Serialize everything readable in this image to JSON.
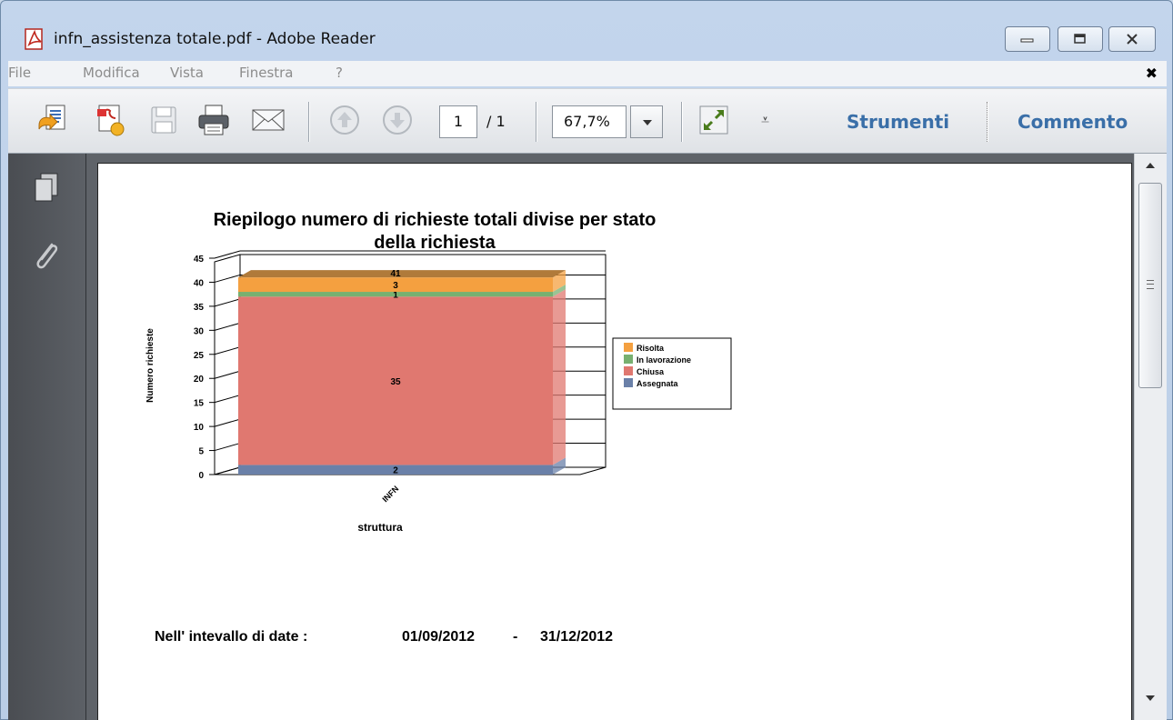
{
  "window": {
    "title": "infn_assistenza totale.pdf - Adobe Reader"
  },
  "menu": {
    "items": [
      "File",
      "Modifica",
      "Vista",
      "Finestra",
      "?"
    ],
    "close_glyph": "✖"
  },
  "toolbar": {
    "icons": [
      "create-pdf-icon",
      "export-icon",
      "save-icon",
      "print-icon",
      "email-icon",
      "page-up-icon",
      "page-down-icon",
      "fit-window-icon"
    ],
    "page_current": "1",
    "page_total": "/ 1",
    "zoom_value": "67,7%",
    "more_glyph": "⩡",
    "tools_label": "Strumenti",
    "comment_label": "Commento"
  },
  "document": {
    "date_label": "Nell' intevallo di date :",
    "date_from": "01/09/2012",
    "date_separator": "-",
    "date_to": "31/12/2012"
  },
  "chart_data": {
    "type": "bar",
    "title": "Riepilogo numero di richieste totali divise per stato della richiesta",
    "title_lines": [
      "Riepilogo numero di richieste totali divise per stato",
      "della richiesta"
    ],
    "xlabel": "struttura",
    "ylabel": "Numero richieste",
    "categories": [
      "INFN"
    ],
    "ylim": [
      0,
      45
    ],
    "yticks": [
      0,
      5,
      10,
      15,
      20,
      25,
      30,
      35,
      40,
      45
    ],
    "stacked": true,
    "total_label": "41",
    "grid": true,
    "legend_position": "right",
    "series": [
      {
        "name": "Assegnata",
        "values": [
          2
        ],
        "color": "#6a80a8"
      },
      {
        "name": "Chiusa",
        "values": [
          35
        ],
        "color": "#e07870"
      },
      {
        "name": "In lavorazione",
        "values": [
          1
        ],
        "color": "#78b070"
      },
      {
        "name": "Risolta",
        "values": [
          3
        ],
        "color": "#f4a040"
      }
    ],
    "legend_order": [
      "Risolta",
      "In lavorazione",
      "Chiusa",
      "Assegnata"
    ]
  }
}
